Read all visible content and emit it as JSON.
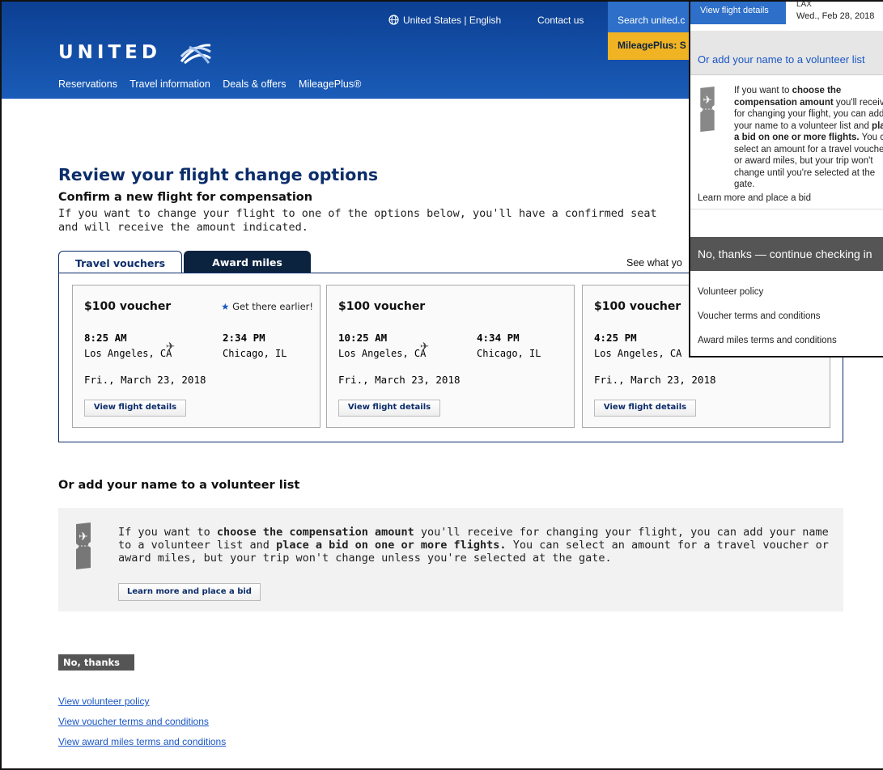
{
  "header": {
    "locale": "United States | English",
    "contact": "Contact us",
    "search": "Search united.c",
    "mileageplus_tab": "MileagePlus: S",
    "logo": "UNITED",
    "nav": [
      "Reservations",
      "Travel information",
      "Deals & offers",
      "MileagePlus®"
    ]
  },
  "main": {
    "title": "Review your flight change options",
    "confirm_heading": "Confirm a new flight for compensation",
    "intro": "If you want to change your flight to one of the options below, you'll have a confirmed seat and will receive the amount indicated.",
    "tabs": [
      {
        "label": "Travel vouchers",
        "active": true
      },
      {
        "label": "Award miles",
        "active": false
      }
    ],
    "see_what": "See what yo",
    "cards": [
      {
        "price": "$100 voucher",
        "badge": "Get there earlier!",
        "dep_time": "8:25 AM",
        "dep_city": "Los Angeles, CA",
        "arr_time": "2:34 PM",
        "arr_city": "Chicago, IL",
        "date": "Fri., March 23, 2018",
        "button": "View flight details"
      },
      {
        "price": "$100 voucher",
        "badge": "",
        "dep_time": "10:25 AM",
        "dep_city": "Los Angeles, CA",
        "arr_time": "4:34 PM",
        "arr_city": "Chicago, IL",
        "date": "Fri., March 23, 2018",
        "button": "View flight details"
      },
      {
        "price": "$100 voucher",
        "badge": "",
        "dep_time": "4:25 PM",
        "dep_city": "Los Angeles, CA",
        "arr_time": "",
        "arr_city": "",
        "date": "Fri., March 23, 2018",
        "button": "View flight details"
      }
    ],
    "volunteer_heading": "Or add your name to a volunteer list",
    "volunteer_text_parts": [
      "If you want to ",
      "choose the compensation amount",
      " you'll receive for changing your flight, you can add your name to a volunteer list and ",
      "place a bid on one or more flights.",
      " You can select an amount for a travel voucher or award miles, but your trip won't change unless you're selected at the gate."
    ],
    "bid_button": "Learn more and place a bid",
    "no_thanks": "No, thanks",
    "links": [
      "View volunteer policy",
      "View voucher terms and conditions",
      "View award miles terms and conditions"
    ]
  },
  "overlay": {
    "button": "View flight details",
    "airport": "LAX",
    "date": "Wed., Feb 28, 2018",
    "title": "Or add your name to a volunteer list",
    "text_parts": [
      "If you want to ",
      "choose the compensation amount",
      " you'll receive for changing your flight, you can add your name to a volunteer list and ",
      "place a bid on one or more flights.",
      " You can select an amount for a travel voucher or award miles, but your trip won't change until you're selected at the gate."
    ],
    "learn": "Learn more and place a bid",
    "no_thanks": "No, thanks — continue checking in",
    "items": [
      "Volunteer policy",
      "Voucher terms and conditions",
      "Award miles terms and conditions"
    ]
  }
}
